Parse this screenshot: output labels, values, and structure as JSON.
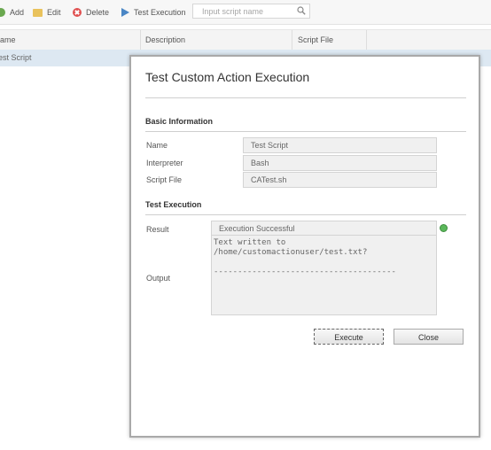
{
  "toolbar": {
    "add_label": "Add",
    "edit_label": "Edit",
    "delete_label": "Delete",
    "test_label": "Test Execution",
    "search_placeholder": "Input script name"
  },
  "grid": {
    "columns": [
      "ame",
      "Description",
      "Script File"
    ],
    "rows": [
      {
        "name": "est Script"
      }
    ]
  },
  "dialog": {
    "title": "Test Custom Action Execution",
    "basic_section": "Basic Information",
    "name_label": "Name",
    "name_value": "Test Script",
    "interpreter_label": "Interpreter",
    "interpreter_value": "Bash",
    "script_file_label": "Script File",
    "script_file_value": "CATest.sh",
    "exec_section": "Test Execution",
    "result_label": "Result",
    "result_value": "Execution Successful",
    "output_label": "Output",
    "output_value": "Text written to\n/home/customactionuser/test.txt?\n\n--------------------------------------",
    "execute_label": "Execute",
    "close_label": "Close",
    "status_color": "#5cb85c"
  }
}
